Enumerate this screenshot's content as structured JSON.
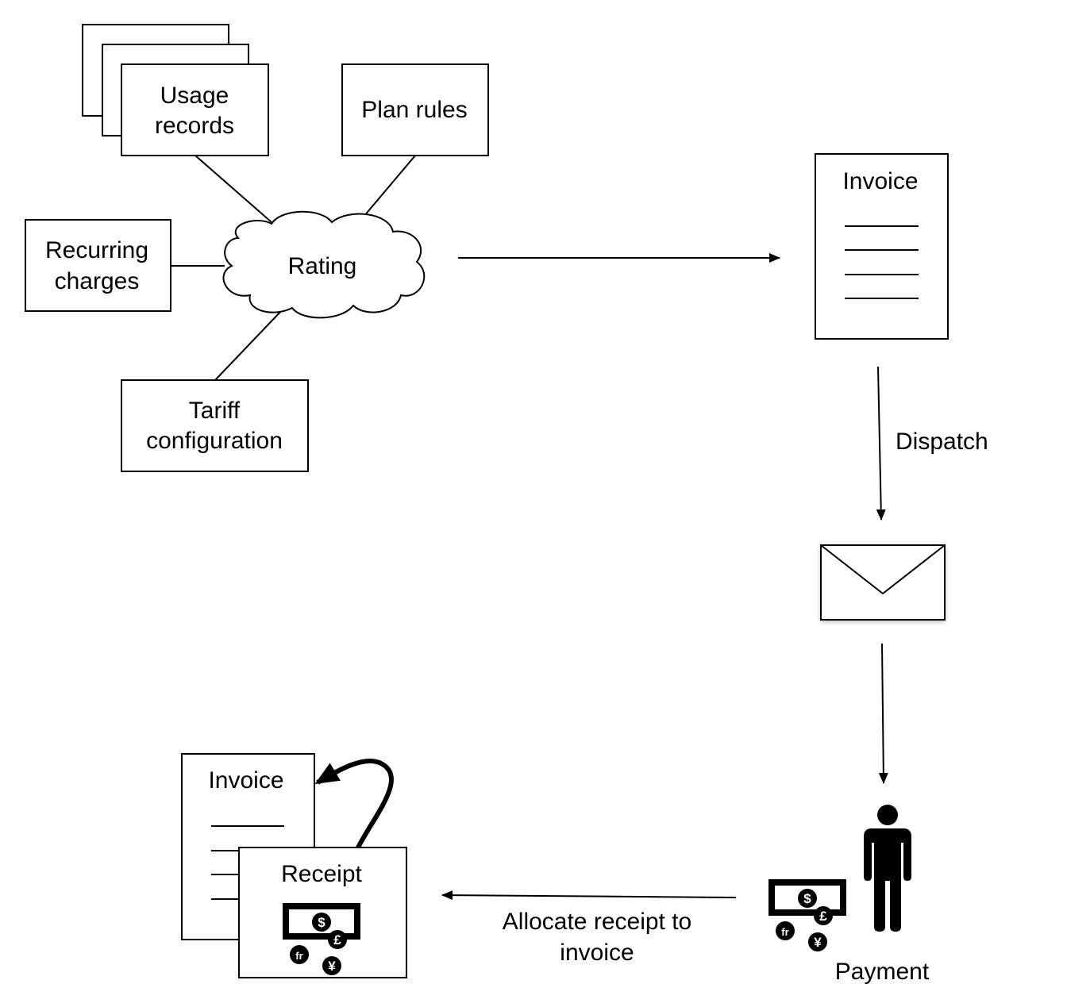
{
  "nodes": {
    "usage_records": [
      "Usage",
      "records"
    ],
    "plan_rules": "Plan rules",
    "recurring_charges": [
      "Recurring",
      "charges"
    ],
    "tariff_configuration": [
      "Tariff",
      "configuration"
    ],
    "rating": "Rating",
    "invoice_top": "Invoice",
    "invoice_bottom": "Invoice",
    "receipt": "Receipt",
    "payment": "Payment"
  },
  "edges": {
    "dispatch": "Dispatch",
    "allocate": [
      "Allocate receipt to",
      "invoice"
    ]
  },
  "icons": {
    "envelope": "envelope-icon",
    "person": "person-icon",
    "money": "money-currency-icon",
    "currency_symbols": [
      "$",
      "£",
      "fr",
      "¥"
    ]
  }
}
